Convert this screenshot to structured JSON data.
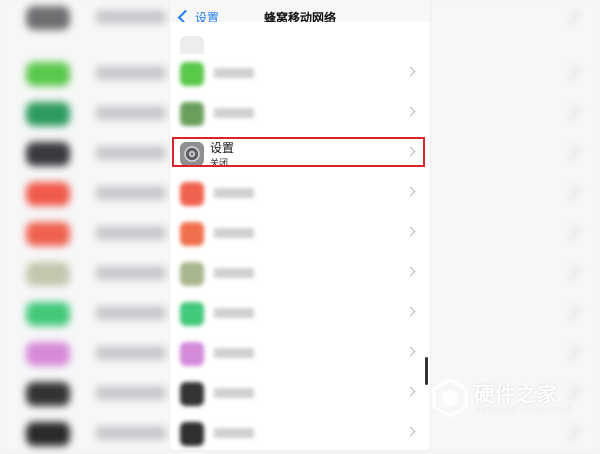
{
  "nav": {
    "back_label": "设置",
    "title": "蜂窝移动网络"
  },
  "rows": [
    {
      "title": "",
      "subtitle": "",
      "icon_color": "#ffffff",
      "partial": true
    },
    {
      "title": "",
      "subtitle": "",
      "icon_color": "#5ac84b"
    },
    {
      "title": "",
      "subtitle": "",
      "icon_color": "#6a9f5b"
    },
    {
      "title": "设置",
      "subtitle": "关闭",
      "icon_color": "#8e8e93",
      "highlighted": true
    },
    {
      "title": "",
      "subtitle": "",
      "icon_color": "#f0614f"
    },
    {
      "title": "",
      "subtitle": "",
      "icon_color": "#f0704e"
    },
    {
      "title": "",
      "subtitle": "",
      "icon_color": "#a9b78e"
    },
    {
      "title": "",
      "subtitle": "",
      "icon_color": "#43c97b"
    },
    {
      "title": "",
      "subtitle": "",
      "icon_color": "#d28ad9"
    },
    {
      "title": "",
      "subtitle": "",
      "icon_color": "#333333"
    },
    {
      "title": "",
      "subtitle": "",
      "icon_color": "#2f2f2f"
    }
  ],
  "background": {
    "icon_colors": [
      "#6f6f72",
      "#5ac84b",
      "#2d9b5f",
      "#3a3a3e",
      "#f05a4c",
      "#f0614f",
      "#c2c8ae",
      "#43c97b",
      "#d68ad6",
      "#333333",
      "#2a2a2a"
    ]
  },
  "watermark": {
    "main": "硬件之家",
    "sub": "YING JIAN ZHI JIA.COM"
  },
  "colors": {
    "accent": "#1a7cf3",
    "highlight_border": "#d9242b"
  }
}
